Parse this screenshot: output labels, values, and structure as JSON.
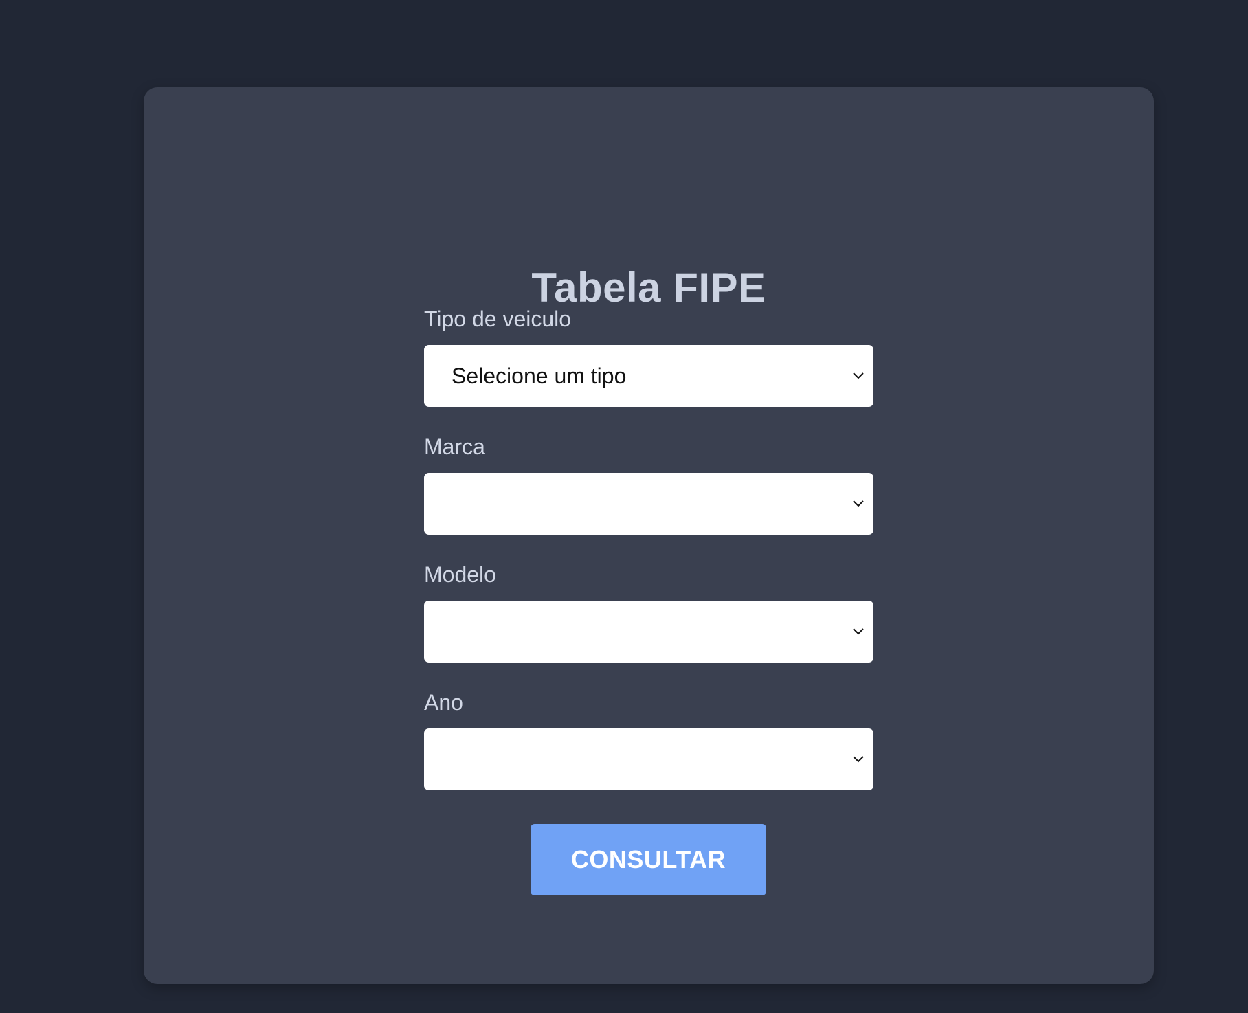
{
  "form": {
    "title": "Tabela FIPE",
    "fields": [
      {
        "label": "Tipo de veiculo",
        "selected": "Selecione um tipo"
      },
      {
        "label": "Marca",
        "selected": ""
      },
      {
        "label": "Modelo",
        "selected": ""
      },
      {
        "label": "Ano",
        "selected": ""
      }
    ],
    "submit_label": "CONSULTAR"
  },
  "colors": {
    "page_background": "#212735",
    "card_background": "#3a4050",
    "title_text": "#ccd3e2",
    "label_text": "#d2d8e6",
    "button_background": "#70a2f5",
    "button_text": "#ffffff"
  },
  "icons": {
    "select_arrow": "chevron-down-icon"
  }
}
